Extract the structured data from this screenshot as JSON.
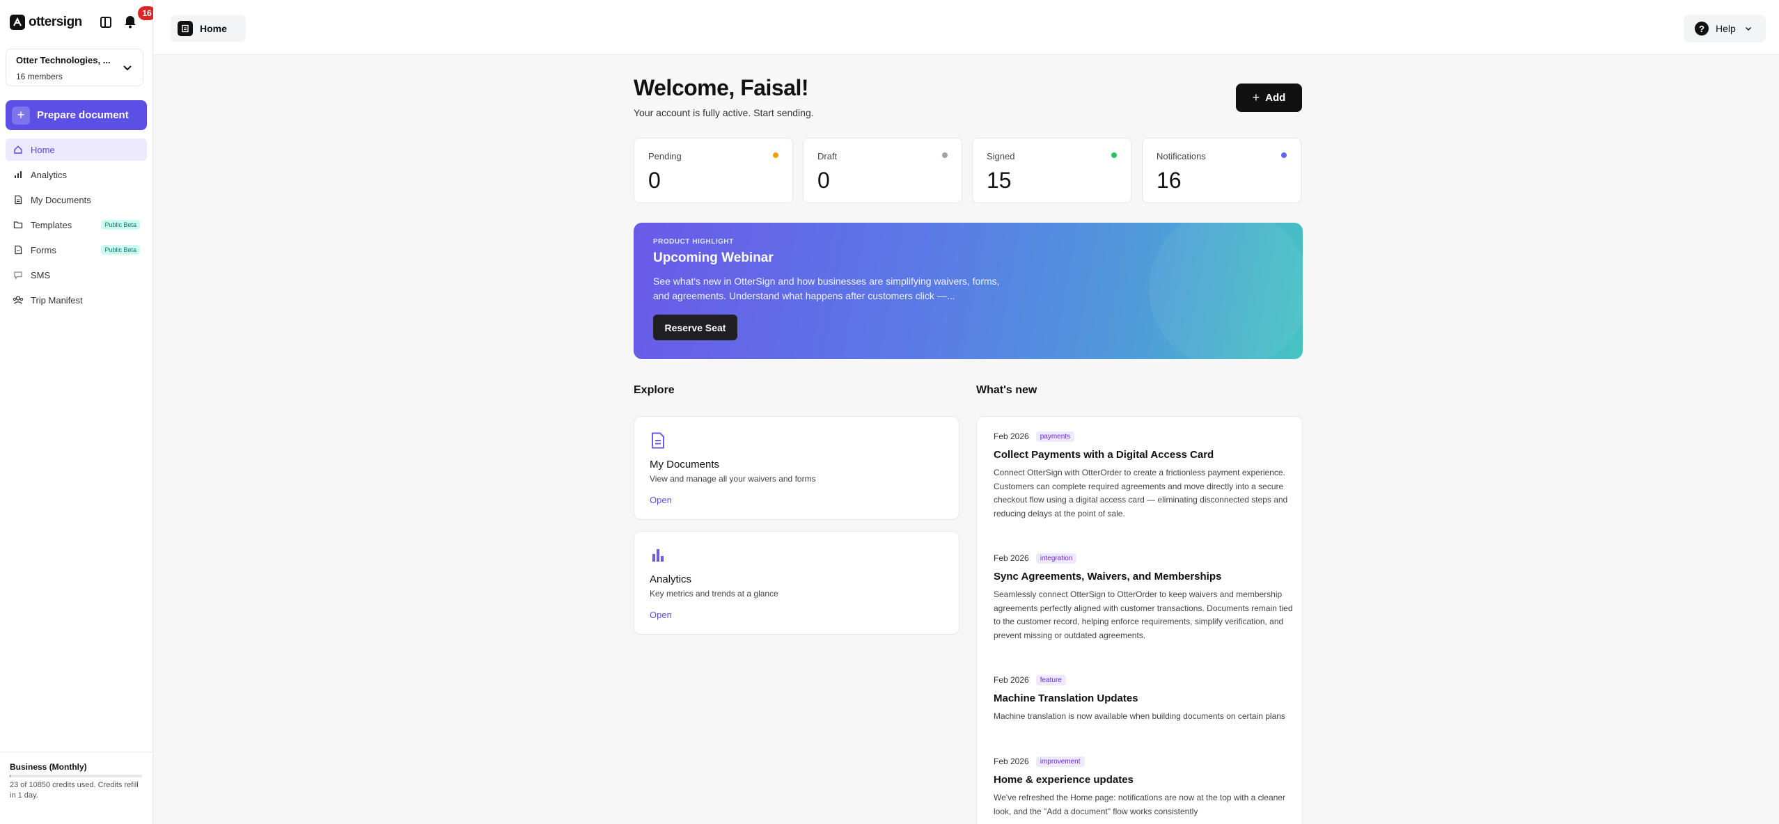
{
  "sidebar": {
    "brand": "ottersign",
    "notification_count": "16",
    "org": {
      "name": "Otter Technologies, ...",
      "members": "16 members"
    },
    "prepare_label": "Prepare document",
    "items": [
      {
        "label": "Home",
        "icon": "home-icon",
        "active": true,
        "badge": ""
      },
      {
        "label": "Analytics",
        "icon": "chart-icon",
        "badge": ""
      },
      {
        "label": "My Documents",
        "icon": "document-icon",
        "badge": ""
      },
      {
        "label": "Templates",
        "icon": "folder-icon",
        "badge": "Public Beta"
      },
      {
        "label": "Forms",
        "icon": "form-icon",
        "badge": "Public Beta"
      },
      {
        "label": "SMS",
        "icon": "chat-icon",
        "badge": ""
      },
      {
        "label": "Trip Manifest",
        "icon": "group-icon",
        "badge": ""
      }
    ],
    "plan": {
      "name": "Business (Monthly)",
      "usage_text": "23 of 10850 credits used. Credits refill in 1 day.",
      "usage_fraction": 0.002
    }
  },
  "header": {
    "breadcrumb": "Home",
    "help_label": "Help"
  },
  "main": {
    "welcome": "Welcome, Faisal!",
    "subtitle": "Your account is fully active. Start sending.",
    "add_label": "Add",
    "stats": [
      {
        "label": "Pending",
        "value": "0",
        "color": "#f59e0b"
      },
      {
        "label": "Draft",
        "value": "0",
        "color": "#9ca3af"
      },
      {
        "label": "Signed",
        "value": "15",
        "color": "#22c55e"
      },
      {
        "label": "Notifications",
        "value": "16",
        "color": "#6366f1"
      }
    ],
    "banner": {
      "kicker": "PRODUCT HIGHLIGHT",
      "title": "Upcoming Webinar",
      "text": "See what's new in OtterSign and how businesses are simplifying waivers, forms, and agreements. Understand what happens after customers click —...",
      "button": "Reserve Seat"
    },
    "explore": {
      "title": "Explore",
      "cards": [
        {
          "title": "My Documents",
          "desc": "View and manage all your waivers and forms",
          "link": "Open"
        },
        {
          "title": "Analytics",
          "desc": "Key metrics and trends at a glance",
          "link": "Open"
        }
      ]
    },
    "whats_new": {
      "title": "What's new",
      "items": [
        {
          "date": "Feb 2026",
          "tag": "payments",
          "title": "Collect Payments with a Digital Access Card",
          "body": "Connect OtterSign with OtterOrder to create a frictionless payment experience. Customers can complete required agreements and move directly into a secure checkout flow using a digital access card — eliminating disconnected steps and reducing delays at the point of sale."
        },
        {
          "date": "Feb 2026",
          "tag": "integration",
          "title": "Sync Agreements, Waivers, and Memberships",
          "body": "Seamlessly connect OtterSign to OtterOrder to keep waivers and membership agreements perfectly aligned with customer transactions. Documents remain tied to the customer record, helping enforce requirements, simplify verification, and prevent missing or outdated agreements."
        },
        {
          "date": "Feb 2026",
          "tag": "feature",
          "title": "Machine Translation Updates",
          "body": "Machine translation is now available when building documents on certain plans"
        },
        {
          "date": "Feb 2026",
          "tag": "improvement",
          "title": "Home & experience updates",
          "body": "We've refreshed the Home page: notifications are now at the top with a cleaner look, and the \"Add a document\" flow works consistently"
        }
      ]
    }
  }
}
